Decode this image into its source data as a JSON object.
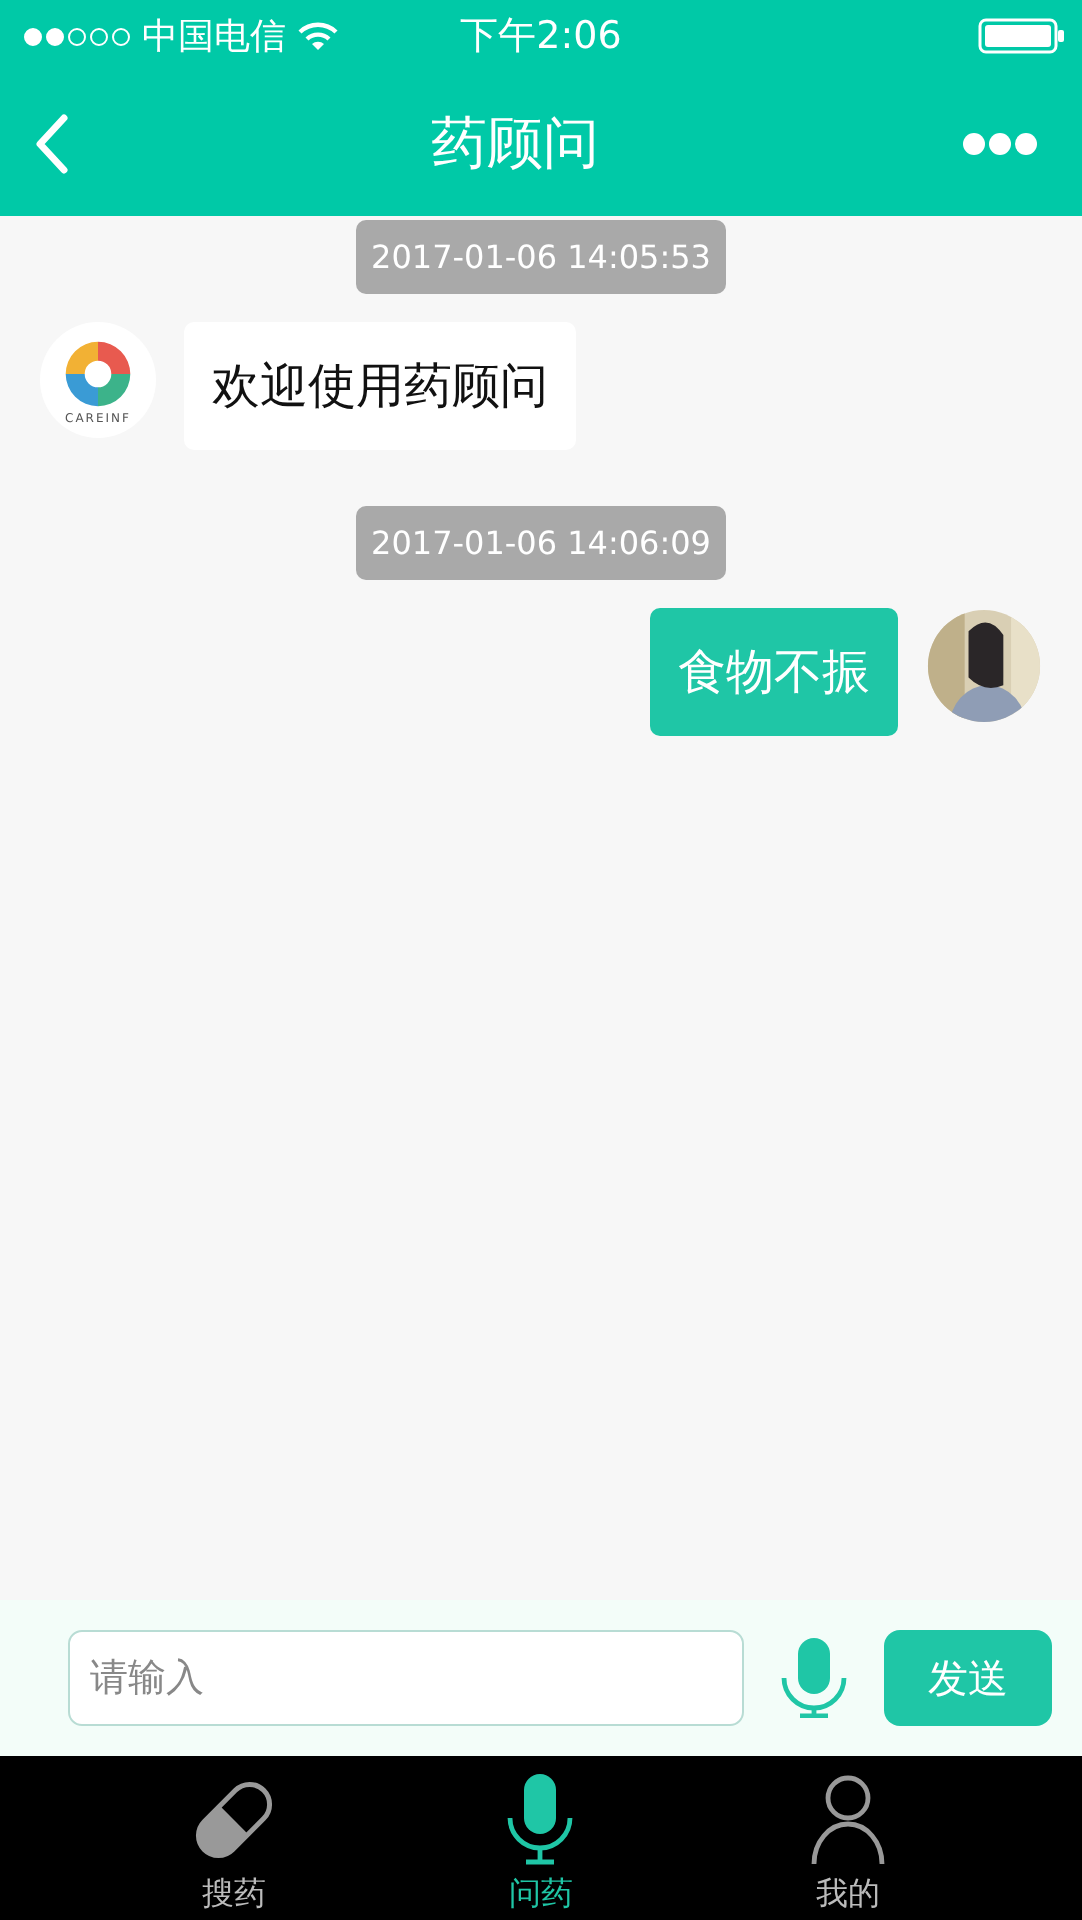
{
  "status_bar": {
    "carrier": "中国电信",
    "time": "下午2:06"
  },
  "nav": {
    "title": "药顾问"
  },
  "messages": [
    {
      "kind": "time",
      "text": "2017-01-06 14:05:53"
    },
    {
      "kind": "bot",
      "text": "欢迎使用药顾问",
      "logo_text": "CAREINF"
    },
    {
      "kind": "time",
      "text": "2017-01-06 14:06:09"
    },
    {
      "kind": "user",
      "text": "食物不振"
    }
  ],
  "input": {
    "placeholder": "请输入",
    "send": "发送"
  },
  "tabs": [
    {
      "label": "搜药",
      "kind": "pill",
      "selected": false
    },
    {
      "label": "问药",
      "kind": "mic",
      "selected": true
    },
    {
      "label": "我的",
      "kind": "person",
      "selected": false
    }
  ]
}
